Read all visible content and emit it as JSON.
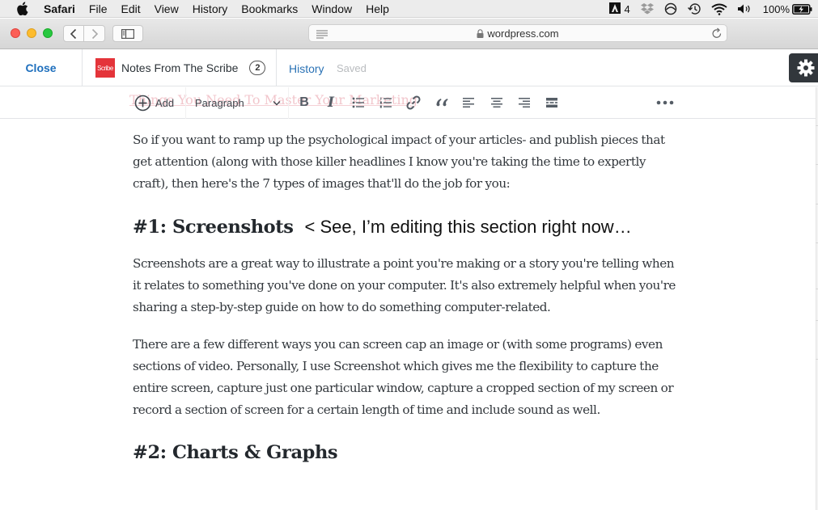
{
  "menubar": {
    "app": "Safari",
    "items": [
      "File",
      "Edit",
      "View",
      "History",
      "Bookmarks",
      "Window",
      "Help"
    ],
    "status": {
      "adobe_count": "4",
      "battery": "100%",
      "icons": [
        "adobe-icon",
        "dropbox-icon",
        "sync-icon",
        "time-machine-icon",
        "wifi-icon",
        "volume-icon",
        "battery-charging-icon"
      ]
    }
  },
  "browser": {
    "url": "wordpress.com"
  },
  "editor_header": {
    "close_label": "Close",
    "site_logo_text": "Scribe",
    "site_name": "Notes From The Scribe",
    "notification_count": "2",
    "history_label": "History",
    "saved_label": "Saved"
  },
  "block_toolbar": {
    "add_label": "Add",
    "block_type": "Paragraph",
    "ghost_title": "Things You Need To Master Your Marketing",
    "buttons": [
      "bold",
      "italic",
      "bulleted-list",
      "numbered-list",
      "link",
      "quote",
      "align-left",
      "align-center",
      "align-right",
      "more-block",
      "more-options"
    ]
  },
  "content": {
    "intro": "So if you want to ramp up the psychological impact of your articles- and publish pieces that get attention (along with those killer headlines I know you're taking the time to expertly craft), then here's the 7 types of images that'll do the job for you:",
    "heading1": "#1: Screenshots",
    "annotation": "< See, I’m editing this section right now…",
    "para1": "Screenshots are a great way to illustrate a point you're making or a story you're telling when it relates to something you've done on your computer. It's also extremely helpful when you're sharing a step-by-step guide on how to do something computer-related.",
    "para2": "There are a few different ways you can screen cap an image or (with some programs) even sections of video. Personally, I use Screenshot which gives me the flexibility to capture the entire screen, capture just one particular window, capture a cropped section of my screen or record a section of screen for a certain length of time and include sound as well.",
    "heading2": "#2: Charts & Graphs"
  },
  "colors": {
    "link_blue": "#1e6fbd",
    "site_logo_red": "#e4343a",
    "settings_dark": "#32373c",
    "saved_gray": "#b9bcbf"
  }
}
